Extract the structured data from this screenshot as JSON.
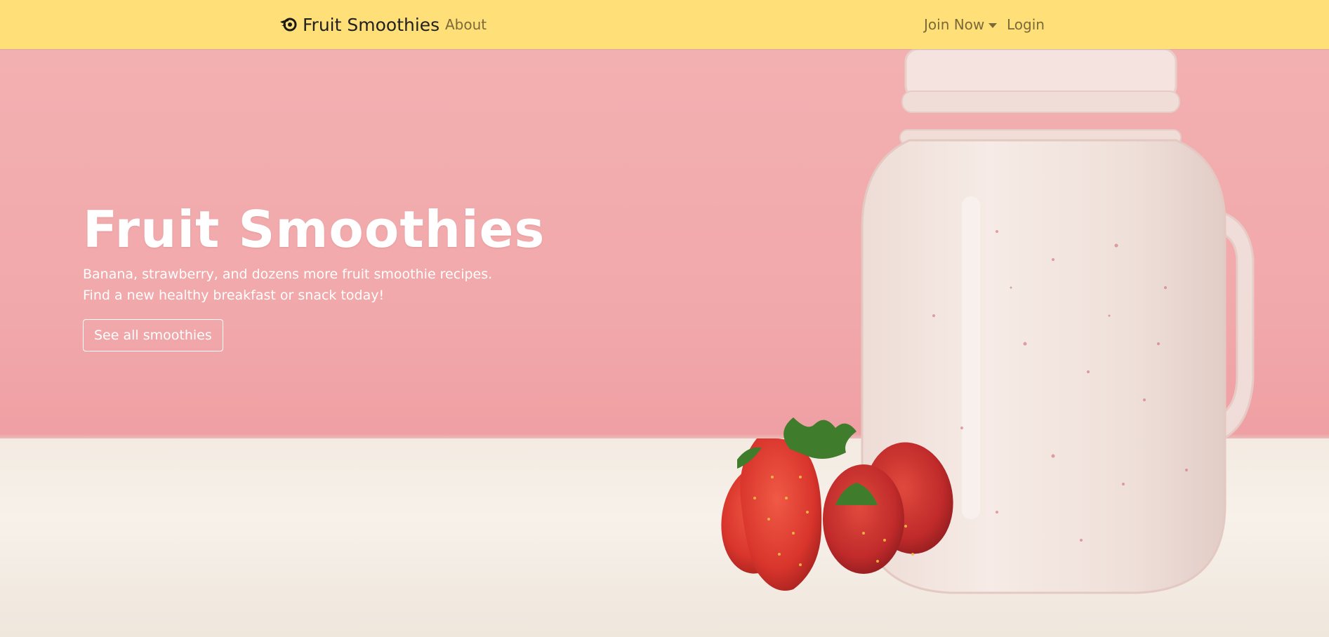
{
  "navbar": {
    "brand_icon": "blender-logo-icon",
    "brand_label": "Fruit Smoothies",
    "about_label": "About",
    "join_label": "Join Now",
    "login_label": "Login",
    "background": "#ffdf78"
  },
  "hero": {
    "title": "Fruit Smoothies",
    "subtitle_line1": "Banana, strawberry, and dozens more fruit smoothie recipes.",
    "subtitle_line2": "Find a new healthy breakfast or snack today!",
    "cta_label": "See all smoothies",
    "background_image": "smoothie-jar-with-strawberries",
    "wall_color": "#f2adaf",
    "table_color": "#f3ebe2"
  }
}
